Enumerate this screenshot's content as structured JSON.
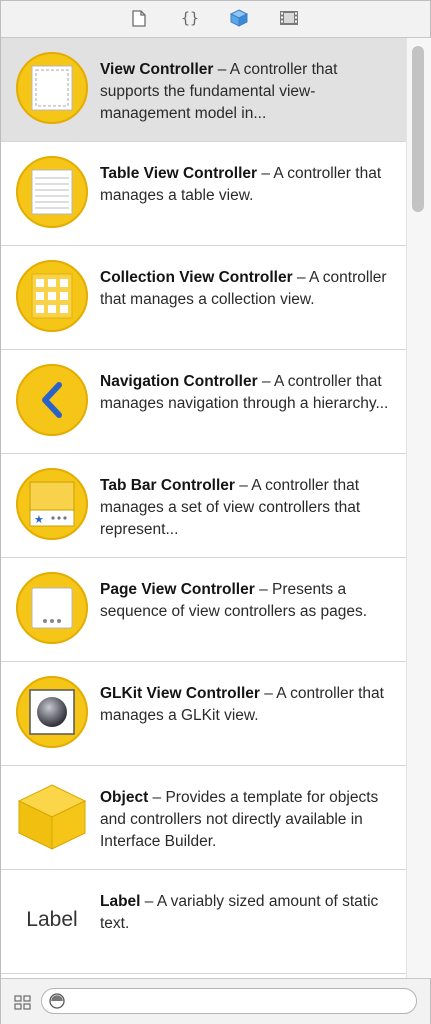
{
  "toolbar": {
    "tabs": [
      {
        "icon": "file-template-icon"
      },
      {
        "icon": "code-snippet-icon",
        "label": "{}"
      },
      {
        "icon": "object-library-icon"
      },
      {
        "icon": "media-library-icon"
      }
    ]
  },
  "library": {
    "items": [
      {
        "title": "View Controller",
        "description": " – A controller that supports the fundamental view-management model in...",
        "icon": "view-controller-icon"
      },
      {
        "title": "Table View Controller",
        "description": " – A controller that manages a table view.",
        "icon": "table-view-controller-icon"
      },
      {
        "title": "Collection View Controller",
        "description": " – A controller that manages a collection view.",
        "icon": "collection-view-controller-icon"
      },
      {
        "title": "Navigation Controller",
        "description": " – A controller that manages navigation through a hierarchy...",
        "icon": "navigation-controller-icon"
      },
      {
        "title": "Tab Bar Controller",
        "description": " – A controller that manages a set of view controllers that represent...",
        "icon": "tab-bar-controller-icon"
      },
      {
        "title": "Page View Controller",
        "description": " – Presents a sequence of view controllers as pages.",
        "icon": "page-view-controller-icon"
      },
      {
        "title": "GLKit View Controller",
        "description": " – A controller that manages a GLKit view.",
        "icon": "glkit-view-controller-icon"
      },
      {
        "title": "Object",
        "description": " – Provides a template for objects and controllers not directly available in Interface Builder.",
        "icon": "object-cube-icon"
      },
      {
        "title": "Label",
        "description": " – A variably sized amount of static text.",
        "icon": "label-icon",
        "icon_text": "Label"
      }
    ]
  },
  "bottom": {
    "filter_value": ""
  },
  "colors": {
    "icon_yellow": "#f5c518",
    "icon_yellow_border": "#e3ad00",
    "nav_chevron": "#2a62c9",
    "selected_row": "#e1e1e1"
  }
}
